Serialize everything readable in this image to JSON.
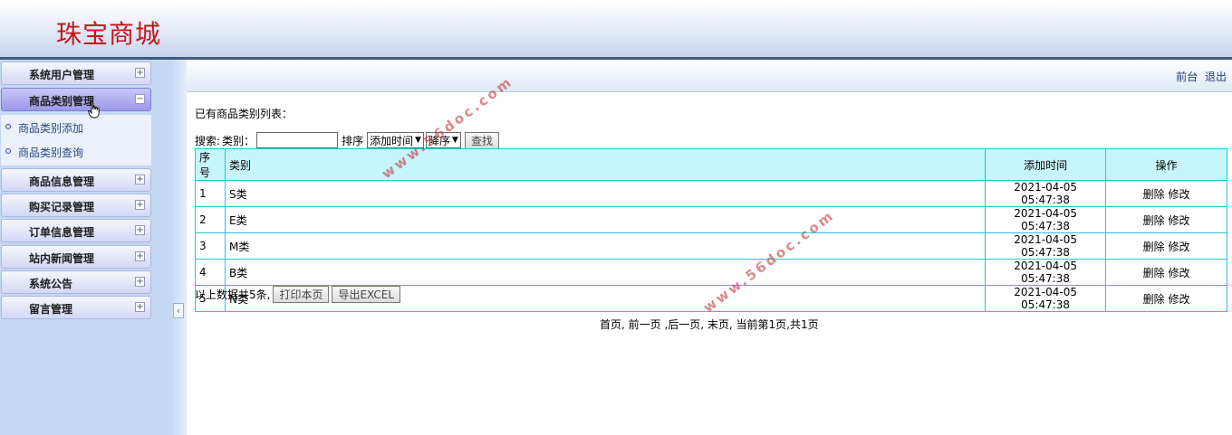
{
  "header": {
    "logo_text": "珠宝商城",
    "logo_color": "#c4161c"
  },
  "topbar": {
    "link_front": "前台",
    "link_logout": "退出"
  },
  "sidebar": {
    "items": [
      {
        "label": "系统用户管理",
        "toggle": "+"
      },
      {
        "label": "商品类别管理",
        "toggle": "−"
      },
      {
        "label": "商品信息管理",
        "toggle": "+"
      },
      {
        "label": "购买记录管理",
        "toggle": "+"
      },
      {
        "label": "订单信息管理",
        "toggle": "+"
      },
      {
        "label": "站内新闻管理",
        "toggle": "+"
      },
      {
        "label": "系统公告",
        "toggle": "+"
      },
      {
        "label": "留言管理",
        "toggle": "+"
      }
    ],
    "submenu": [
      {
        "label": "商品类别添加"
      },
      {
        "label": "商品类别查询"
      }
    ],
    "collapse_glyph": "‹"
  },
  "main": {
    "list_title": "已有商品类别列表：",
    "search": {
      "label_search": "搜索:",
      "label_category": "类别：",
      "category_value": "",
      "label_sort": "排序",
      "sort_field": "添加时间",
      "sort_order": "降序",
      "search_button": "查找"
    },
    "table": {
      "headers": [
        "序号",
        "类别",
        "添加时间",
        "操作"
      ],
      "rows": [
        {
          "no": "1",
          "category": "S类",
          "time": "2021-04-05 05:47:38",
          "delete": "删除",
          "edit": "修改"
        },
        {
          "no": "2",
          "category": "E类",
          "time": "2021-04-05 05:47:38",
          "delete": "删除",
          "edit": "修改"
        },
        {
          "no": "3",
          "category": "M类",
          "time": "2021-04-05 05:47:38",
          "delete": "删除",
          "edit": "修改"
        },
        {
          "no": "4",
          "category": "B类",
          "time": "2021-04-05 05:47:38",
          "delete": "删除",
          "edit": "修改"
        },
        {
          "no": "5",
          "category": "N类",
          "time": "2021-04-05 05:47:38",
          "delete": "删除",
          "edit": "修改"
        }
      ]
    },
    "footer": {
      "total_text": "以上数据共5条,",
      "print_button": "打印本页",
      "export_button": "导出EXCEL"
    },
    "pager": "首页, 前一页 ,后一页, 末页, 当前第1页,共1页"
  },
  "watermark": {
    "text": "www.56doc.com"
  }
}
